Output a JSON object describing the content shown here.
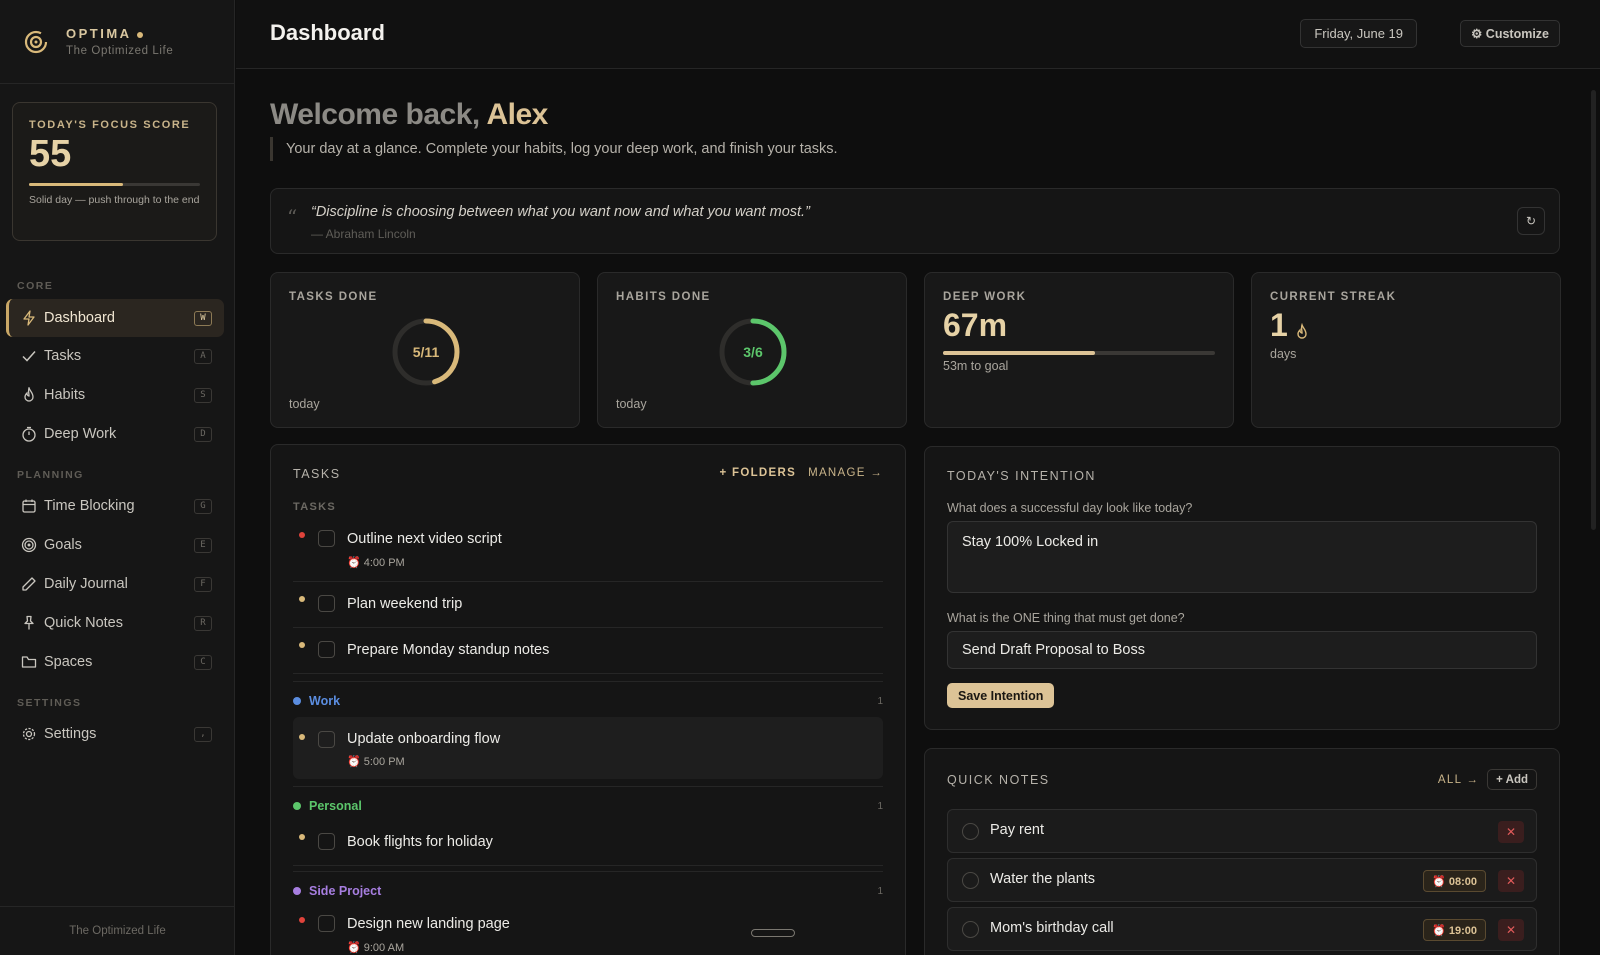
{
  "brand": {
    "name": "OPTIMA",
    "tagline": "The Optimized Life"
  },
  "focus": {
    "label": "TODAY'S FOCUS SCORE",
    "score": "55",
    "progress": 0.55,
    "desc": "Solid day — push through to the end"
  },
  "nav": {
    "core_label": "CORE",
    "planning_label": "PLANNING",
    "settings_label": "SETTINGS",
    "core": [
      {
        "label": "Dashboard",
        "key": "W",
        "icon": "lightning-icon"
      },
      {
        "label": "Tasks",
        "key": "A",
        "icon": "check-icon"
      },
      {
        "label": "Habits",
        "key": "S",
        "icon": "flame-icon"
      },
      {
        "label": "Deep Work",
        "key": "D",
        "icon": "timer-icon"
      }
    ],
    "planning": [
      {
        "label": "Time Blocking",
        "key": "G",
        "icon": "calendar-icon"
      },
      {
        "label": "Goals",
        "key": "E",
        "icon": "target-icon"
      },
      {
        "label": "Daily Journal",
        "key": "F",
        "icon": "pencil-icon"
      },
      {
        "label": "Quick Notes",
        "key": "R",
        "icon": "pin-icon"
      },
      {
        "label": "Spaces",
        "key": "C",
        "icon": "folder-icon"
      }
    ],
    "settings": [
      {
        "label": "Settings",
        "key": ",",
        "icon": "gear-icon"
      }
    ]
  },
  "sidebar_footer": "The Optimized Life",
  "header": {
    "title": "Dashboard",
    "date": "Friday, June 19",
    "customize": "⚙ Customize"
  },
  "welcome": {
    "prefix": "Welcome back, ",
    "name": "Alex",
    "subtitle": "Your day at a glance. Complete your habits, log your deep work, and finish your tasks."
  },
  "quote": {
    "text": "“Discipline is choosing between what you want now and what you want most.”",
    "author": "— Abraham Lincoln",
    "refresh": "↻"
  },
  "stats": {
    "tasks": {
      "label": "TASKS DONE",
      "value": "5/11",
      "sub": "today",
      "progress": 0.4545,
      "color": "#d9b97a"
    },
    "habits": {
      "label": "HABITS DONE",
      "value": "3/6",
      "sub": "today",
      "progress": 0.5,
      "color": "#5cc66b"
    },
    "deepwork": {
      "label": "DEEP WORK",
      "value": "67m",
      "sub": "53m to goal",
      "progress": 0.56
    },
    "streak": {
      "label": "CURRENT STREAK",
      "value": "1",
      "sub": "days"
    }
  },
  "tasks_panel": {
    "title": "TASKS",
    "folders_btn": "+ FOLDERS",
    "manage_btn": "MANAGE →",
    "group_label": "TASKS",
    "loose": [
      {
        "title": "Outline next video script",
        "time": "⏰ 4:00 PM",
        "prio": "#e0433b"
      },
      {
        "title": "Plan weekend trip",
        "time": "",
        "prio": "#d9b97a"
      },
      {
        "title": "Prepare Monday standup notes",
        "time": "",
        "prio": "#d9b97a"
      }
    ],
    "folders": [
      {
        "name": "Work",
        "count": "1",
        "color": "#5b8de0",
        "task": {
          "title": "Update onboarding flow",
          "time": "⏰ 5:00 PM",
          "prio": "#d9b97a"
        }
      },
      {
        "name": "Personal",
        "count": "1",
        "color": "#5cc66b",
        "task": {
          "title": "Book flights for holiday",
          "time": "",
          "prio": "#d9b97a"
        }
      },
      {
        "name": "Side Project",
        "count": "1",
        "color": "#a77ee0",
        "task": {
          "title": "Design new landing page",
          "time": "⏰ 9:00 AM",
          "prio": "#e0433b"
        }
      }
    ]
  },
  "intention": {
    "title": "TODAY'S INTENTION",
    "q1": "What does a successful day look like today?",
    "a1": "Stay 100% Locked in",
    "q2": "What is the ONE thing that must get done?",
    "a2": "Send Draft Proposal to Boss",
    "save": "Save Intention"
  },
  "notes": {
    "title": "QUICK NOTES",
    "all": "ALL →",
    "add": "+ Add",
    "items": [
      {
        "text": "Pay rent",
        "time": ""
      },
      {
        "text": "Water the plants",
        "time": "⏰ 08:00"
      },
      {
        "text": "Mom's birthday call",
        "time": "⏰ 19:00"
      }
    ]
  }
}
